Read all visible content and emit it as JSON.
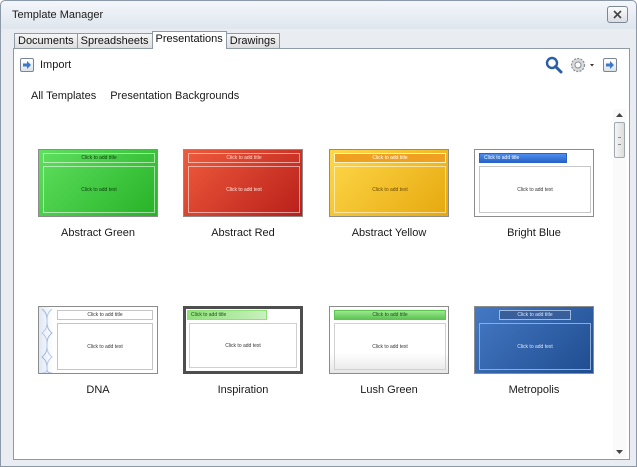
{
  "window": {
    "title": "Template Manager"
  },
  "tabs": [
    {
      "label": "Documents"
    },
    {
      "label": "Spreadsheets"
    },
    {
      "label": "Presentations"
    },
    {
      "label": "Drawings"
    }
  ],
  "toolbar": {
    "import_label": "Import",
    "search_icon": "search-icon",
    "settings_icon": "gear-icon",
    "export_icon": "export-arrow-icon"
  },
  "filters": {
    "all_templates": "All Templates",
    "current_folder": "Presentation Backgrounds"
  },
  "thumbnail_text": {
    "title": "Click to add title",
    "body": "Click to add text"
  },
  "templates": [
    {
      "name": "Abstract Green",
      "color": "#3cc93c"
    },
    {
      "name": "Abstract Red",
      "color": "#d9352a"
    },
    {
      "name": "Abstract Yellow",
      "color": "#f2c220"
    },
    {
      "name": "Bright Blue",
      "color": "#2f6fd6"
    },
    {
      "name": "DNA",
      "color": "#ffffff"
    },
    {
      "name": "Inspiration",
      "color": "#5a5a5a"
    },
    {
      "name": "Lush Green",
      "color": "#62c95b"
    },
    {
      "name": "Metropolis",
      "color": "#2b5ea8"
    }
  ]
}
